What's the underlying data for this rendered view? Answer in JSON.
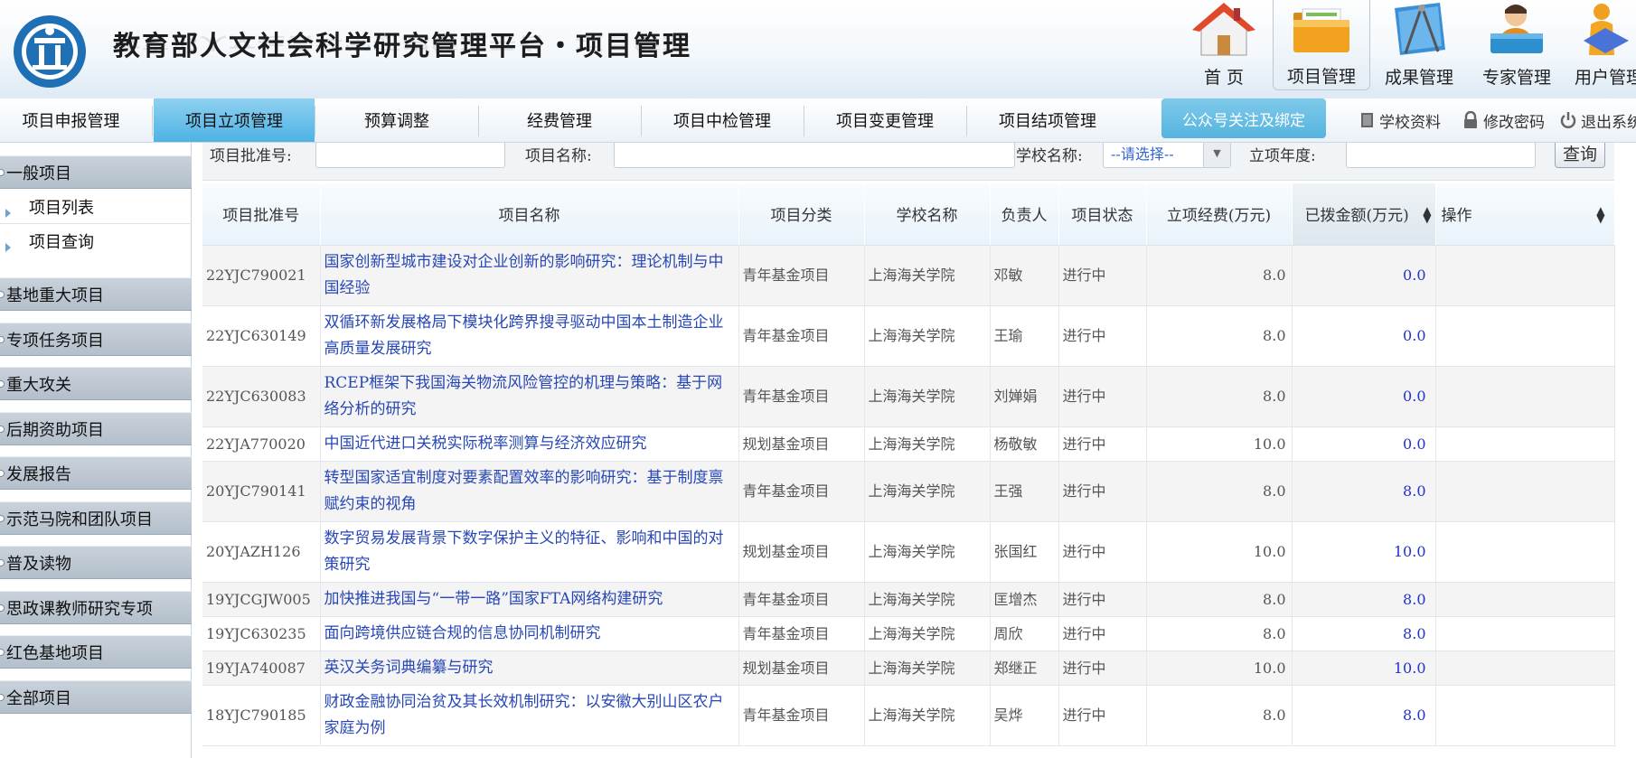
{
  "header": {
    "title": "教育部人文社会科学研究管理平台・项目管理",
    "top_nav": [
      {
        "label": "首 页",
        "icon": "home-icon",
        "active": false
      },
      {
        "label": "项目管理",
        "icon": "folder-icon",
        "active": true
      },
      {
        "label": "成果管理",
        "icon": "compass-icon",
        "active": false
      },
      {
        "label": "专家管理",
        "icon": "expert-icon",
        "active": false
      },
      {
        "label": "用户管理",
        "icon": "user-icon",
        "active": false
      }
    ]
  },
  "menubar": {
    "items": [
      {
        "label": "项目申报管理",
        "active": false
      },
      {
        "label": "项目立项管理",
        "active": true
      },
      {
        "label": "预算调整",
        "active": false
      },
      {
        "label": "经费管理",
        "active": false
      },
      {
        "label": "项目中检管理",
        "active": false
      },
      {
        "label": "项目变更管理",
        "active": false
      },
      {
        "label": "项目结项管理",
        "active": false
      }
    ],
    "wechat_button": "公众号关注及绑定",
    "util_links": {
      "school_info": "学校资料",
      "change_password": "修改密码",
      "logout": "退出系统"
    }
  },
  "sidebar": {
    "general": "一般项目",
    "project_list": "项目列表",
    "project_query": "项目查询",
    "groups": [
      "基地重大项目",
      "专项任务项目",
      "重大攻关",
      "后期资助项目",
      "发展报告",
      "示范马院和团队项目",
      "普及读物",
      "思政课教师研究专项",
      "红色基地项目",
      "全部项目"
    ]
  },
  "search": {
    "approval_no_label": "项目批准号:",
    "approval_no_value": "",
    "name_label": "项目名称:",
    "name_value": "",
    "school_label": "学校名称:",
    "school_value": "--请选择--",
    "year_label": "立项年度:",
    "year_value": "",
    "query_button": "查询"
  },
  "table": {
    "columns": [
      "项目批准号",
      "项目名称",
      "项目分类",
      "学校名称",
      "负责人",
      "项目状态",
      "立项经费(万元)",
      "已拨金额(万元)",
      "操作"
    ],
    "rows": [
      {
        "no": "22YJC790021",
        "name": "国家创新型城市建设对企业创新的影响研究：理论机制与中国经验",
        "cat": "青年基金项目",
        "school": "上海海关学院",
        "lead": "邓敏",
        "status": "进行中",
        "budget": "8.0",
        "paid": "0.0",
        "op": ""
      },
      {
        "no": "22YJC630149",
        "name": "双循环新发展格局下模块化跨界搜寻驱动中国本土制造企业高质量发展研究",
        "cat": "青年基金项目",
        "school": "上海海关学院",
        "lead": "王瑜",
        "status": "进行中",
        "budget": "8.0",
        "paid": "0.0",
        "op": ""
      },
      {
        "no": "22YJC630083",
        "name": "RCEP框架下我国海关物流风险管控的机理与策略：基于网络分析的研究",
        "cat": "青年基金项目",
        "school": "上海海关学院",
        "lead": "刘婵娟",
        "status": "进行中",
        "budget": "8.0",
        "paid": "0.0",
        "op": ""
      },
      {
        "no": "22YJA770020",
        "name": "中国近代进口关税实际税率测算与经济效应研究",
        "cat": "规划基金项目",
        "school": "上海海关学院",
        "lead": "杨敬敏",
        "status": "进行中",
        "budget": "10.0",
        "paid": "0.0",
        "op": ""
      },
      {
        "no": "20YJC790141",
        "name": "转型国家适宜制度对要素配置效率的影响研究：基于制度禀赋约束的视角",
        "cat": "青年基金项目",
        "school": "上海海关学院",
        "lead": "王强",
        "status": "进行中",
        "budget": "8.0",
        "paid": "8.0",
        "op": ""
      },
      {
        "no": "20YJAZH126",
        "name": "数字贸易发展背景下数字保护主义的特征、影响和中国的对策研究",
        "cat": "规划基金项目",
        "school": "上海海关学院",
        "lead": "张国红",
        "status": "进行中",
        "budget": "10.0",
        "paid": "10.0",
        "op": ""
      },
      {
        "no": "19YJCGJW005",
        "name": "加快推进我国与“一带一路”国家FTA网络构建研究",
        "cat": "青年基金项目",
        "school": "上海海关学院",
        "lead": "匡增杰",
        "status": "进行中",
        "budget": "8.0",
        "paid": "8.0",
        "op": ""
      },
      {
        "no": "19YJC630235",
        "name": "面向跨境供应链合规的信息协同机制研究",
        "cat": "青年基金项目",
        "school": "上海海关学院",
        "lead": "周欣",
        "status": "进行中",
        "budget": "8.0",
        "paid": "8.0",
        "op": ""
      },
      {
        "no": "19YJA740087",
        "name": "英汉关务词典编纂与研究",
        "cat": "规划基金项目",
        "school": "上海海关学院",
        "lead": "郑继正",
        "status": "进行中",
        "budget": "10.0",
        "paid": "10.0",
        "op": ""
      },
      {
        "no": "18YJC790185",
        "name": "财政金融协同治贫及其长效机制研究：以安徽大别山区农户家庭为例",
        "cat": "青年基金项目",
        "school": "上海海关学院",
        "lead": "吴烨",
        "status": "进行中",
        "budget": "8.0",
        "paid": "8.0",
        "op": ""
      }
    ]
  },
  "colors": {
    "menu_active": "#4db3e5",
    "link": "#2747b6",
    "sidebar_group": "#b3bfcb"
  }
}
